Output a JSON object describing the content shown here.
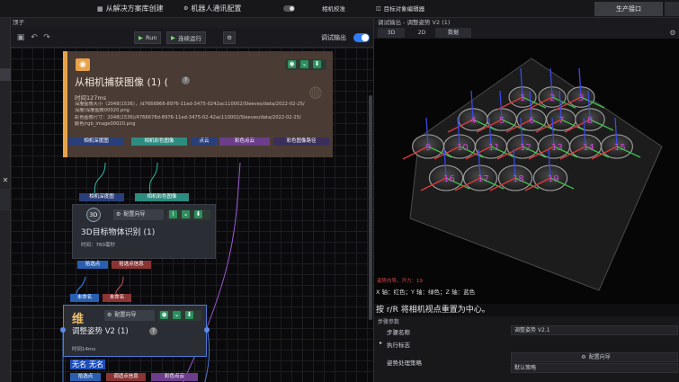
{
  "topbar": {
    "items": [
      "从解决方案库创建",
      "机器人通讯配置",
      "相机校准",
      "目标对象编辑器"
    ],
    "right_tab": "生产接口"
  },
  "graph": {
    "header": "顶子",
    "run_label": "Run",
    "step_label": "连续运行",
    "debug_output_label": "调试输出"
  },
  "nodes": {
    "capture": {
      "title": "从相机捕获图像 (1) (",
      "time": "时间127ms",
      "info_lines": [
        "深度图像大小（2048(1536），/d7666866-8976-11ed-3475-0242ac110002/SIeeves/data/2022-02-25/",
        "深度/深度图像00020.png",
        "彩色图像尺寸：2048(1536)/4766678d-8976-11ed-3475-02-42ac110002/SIeeves/data/2022-02-25/",
        "颜色/rgb_image00020.png"
      ],
      "outputs": [
        "相机深度图",
        "相机彩色图像",
        "点云",
        "彩色点云",
        "彩色图像路径"
      ]
    },
    "detect": {
      "inputs": [
        "相机深度图",
        "相机彩色图像"
      ],
      "config_label": "配置向导",
      "title": "3D目标物体识别 (1)",
      "time": "时间：760毫秒",
      "outputs": [
        "拾选点",
        "拾选点信息"
      ]
    },
    "adjust": {
      "inputs": [
        "未命名",
        "未命名"
      ],
      "badge": "维",
      "config_label": "配置向导",
      "title": "调整姿势 V2 (1)",
      "time": "时间14ms",
      "unnamed_labels": [
        "无名",
        "无名"
      ],
      "outputs": [
        "拾选点",
        "调适点信息",
        "彩色点云"
      ]
    }
  },
  "right": {
    "header": "调试输出 - 调整姿势 V2 (1)",
    "tabs": [
      "3D",
      "2D",
      "数据"
    ],
    "viewer_overlay_red": "姿势向导，开力：19",
    "axis_legend": "X 轴：红色；Y 轴：绿色；Z 轴：蓝色",
    "reset_hint": "按 r/R 将相机视点重置为中心。",
    "params_title": "步骤参数",
    "step_name_label": "步骤名称",
    "step_name_value": "调整姿势 V2.1",
    "exec_label": "执行标志",
    "strategy_label": "姿势处理策略",
    "config_button": "配置向导",
    "default_strategy": "默认策略",
    "cup_labels": [
      "1",
      "2",
      "3",
      "4",
      "5",
      "6",
      "7",
      "8",
      "9",
      "10",
      "11",
      "12",
      "13",
      "14",
      "15",
      "16",
      "17",
      "18",
      "19"
    ]
  },
  "colors": {
    "accent": "#2f7cf6",
    "capture_header": "#e8a24a",
    "capture_body": "#4a3c34",
    "port_blue": "#2a3f7a",
    "port_teal": "#2d8b80",
    "port_green": "#2a8a4d",
    "port_purple": "#6b3d8b",
    "port_red": "#8a3434",
    "node_body": "#2a2d33"
  }
}
